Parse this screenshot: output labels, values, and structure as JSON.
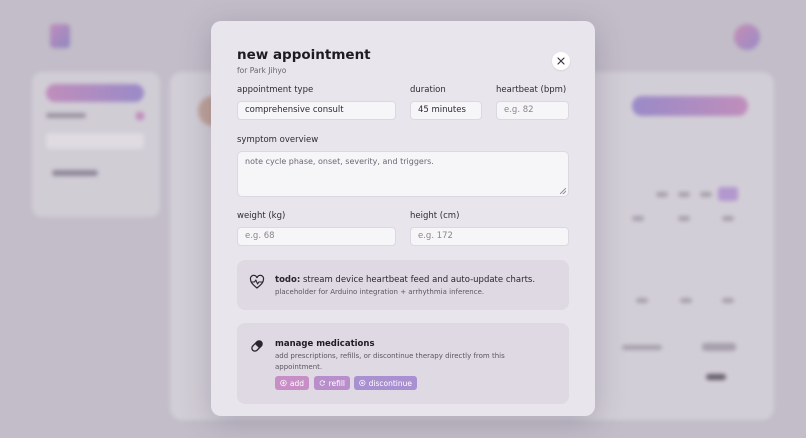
{
  "modal": {
    "title": "new appointment",
    "subtitle": "for Park Jihyo",
    "fields": {
      "appointment_type": {
        "label": "appointment type",
        "value": "comprehensive consult"
      },
      "duration": {
        "label": "duration",
        "value": "45 minutes"
      },
      "heartbeat": {
        "label": "heartbeat (bpm)",
        "placeholder": "e.g. 82"
      },
      "symptom_overview": {
        "label": "symptom overview",
        "placeholder": "note cycle phase, onset, severity, and triggers."
      },
      "weight": {
        "label": "weight (kg)",
        "placeholder": "e.g. 68"
      },
      "height": {
        "label": "height (cm)",
        "placeholder": "e.g. 172"
      }
    },
    "todo_card": {
      "icon": "heart-pulse-icon",
      "prefix": "todo:",
      "text": "stream device heartbeat feed and auto-update charts.",
      "sub": "placeholder for Arduino integration + arrhythmia inference."
    },
    "medications_card": {
      "icon": "pill-icon",
      "title": "manage medications",
      "description": "add prescriptions, refills, or discontinue therapy directly from this appointment.",
      "actions": {
        "add": "add",
        "refill": "refill",
        "discontinue": "discontinue"
      }
    }
  },
  "colors": {
    "accent_pink": "#c88ec6",
    "accent_purple": "#a990d0",
    "modal_bg": "#e8e6ec"
  }
}
